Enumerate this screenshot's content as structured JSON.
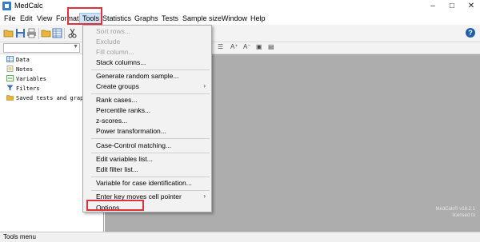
{
  "window": {
    "title": "MedCalc",
    "controls": [
      "–",
      "□",
      "✕"
    ]
  },
  "menubar": {
    "items": [
      "File",
      "Edit",
      "View",
      "Format",
      "Tools",
      "Statistics",
      "Graphs",
      "Tests",
      "Sample size",
      "Window",
      "Help"
    ],
    "active": "Tools"
  },
  "tree": {
    "items": [
      {
        "label": "Data",
        "icon": "data-sheet-icon"
      },
      {
        "label": "Notes",
        "icon": "notes-icon"
      },
      {
        "label": "Variables",
        "icon": "variables-icon"
      },
      {
        "label": "Filters",
        "icon": "filter-icon"
      },
      {
        "label": "Saved tests and graphs",
        "icon": "folder-icon"
      }
    ]
  },
  "tools_menu": {
    "items": [
      {
        "label": "Sort rows...",
        "disabled": true
      },
      {
        "label": "Exclude",
        "disabled": true
      },
      {
        "label": "Fill column...",
        "disabled": true
      },
      {
        "label": "Stack columns...",
        "disabled": false
      },
      {
        "label": "Generate random sample...",
        "disabled": false
      },
      {
        "label": "Create groups",
        "disabled": false,
        "submenu": true
      },
      {
        "label": "Rank cases...",
        "disabled": false
      },
      {
        "label": "Percentile ranks...",
        "disabled": false
      },
      {
        "label": "z-scores...",
        "disabled": false
      },
      {
        "label": "Power transformation...",
        "disabled": false
      },
      {
        "label": "Case-Control matching...",
        "disabled": false
      },
      {
        "label": "Edit variables list...",
        "disabled": false
      },
      {
        "label": "Edit filter list...",
        "disabled": false
      },
      {
        "label": "Variable for case identification...",
        "disabled": false
      },
      {
        "label": "Enter key moves cell pointer",
        "disabled": false,
        "submenu": true
      },
      {
        "label": "Options...",
        "disabled": false
      }
    ]
  },
  "watermark": {
    "line1": "MedCalc® v18.2.1",
    "line2": "licensed to"
  },
  "status": {
    "text": "Tools menu"
  },
  "help": {
    "label": "?"
  },
  "colors": {
    "highlight_box": "#e0323c",
    "workspace": "#adadad",
    "menu_bg": "#f2f2f2"
  }
}
